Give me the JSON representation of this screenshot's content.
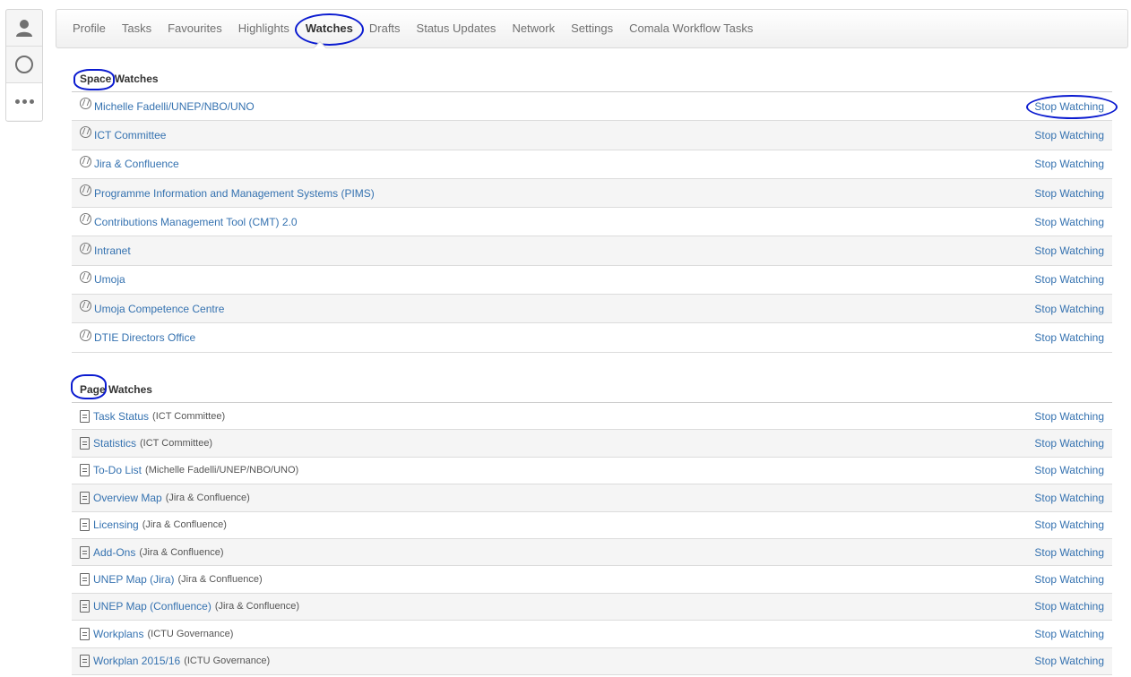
{
  "nav": {
    "tabs": [
      {
        "label": "Profile"
      },
      {
        "label": "Tasks"
      },
      {
        "label": "Favourites"
      },
      {
        "label": "Highlights"
      },
      {
        "label": "Watches"
      },
      {
        "label": "Drafts"
      },
      {
        "label": "Status Updates"
      },
      {
        "label": "Network"
      },
      {
        "label": "Settings"
      },
      {
        "label": "Comala Workflow Tasks"
      }
    ],
    "active": "Watches"
  },
  "sidebar": {
    "icons": [
      "user-icon",
      "circle-icon",
      "more-icon"
    ]
  },
  "space_watches": {
    "title": "Space Watches",
    "stop_label": "Stop Watching",
    "items": [
      {
        "name": "Michelle Fadelli/UNEP/NBO/UNO"
      },
      {
        "name": "ICT Committee"
      },
      {
        "name": "Jira & Confluence"
      },
      {
        "name": "Programme Information and Management Systems (PIMS)"
      },
      {
        "name": "Contributions Management Tool (CMT) 2.0"
      },
      {
        "name": "Intranet"
      },
      {
        "name": "Umoja"
      },
      {
        "name": "Umoja Competence Centre"
      },
      {
        "name": "DTIE Directors Office"
      }
    ]
  },
  "page_watches": {
    "title": "Page Watches",
    "stop_label": "Stop Watching",
    "items": [
      {
        "name": "Task Status",
        "context": "(ICT Committee)"
      },
      {
        "name": "Statistics",
        "context": "(ICT Committee)"
      },
      {
        "name": "To-Do List",
        "context": "(Michelle Fadelli/UNEP/NBO/UNO)"
      },
      {
        "name": "Overview Map",
        "context": "(Jira & Confluence)"
      },
      {
        "name": "Licensing",
        "context": "(Jira & Confluence)"
      },
      {
        "name": "Add-Ons",
        "context": "(Jira & Confluence)"
      },
      {
        "name": "UNEP Map (Jira)",
        "context": "(Jira & Confluence)"
      },
      {
        "name": "UNEP Map (Confluence)",
        "context": "(Jira & Confluence)"
      },
      {
        "name": "Workplans",
        "context": "(ICTU Governance)"
      },
      {
        "name": "Workplan 2015/16",
        "context": "(ICTU Governance)"
      }
    ]
  },
  "colors": {
    "link": "#3572b0",
    "annotation": "#0b1bd0"
  }
}
